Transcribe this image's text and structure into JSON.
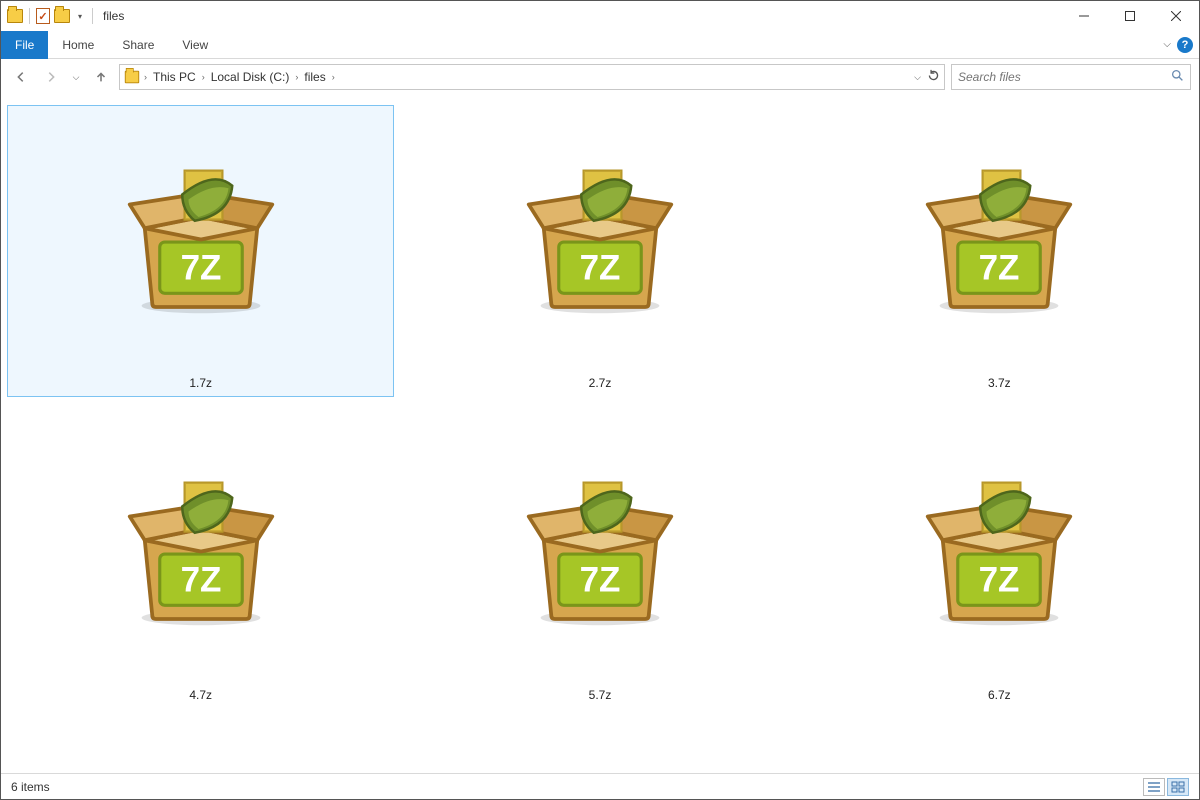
{
  "window": {
    "title": "files"
  },
  "tabs": {
    "file": "File",
    "home": "Home",
    "share": "Share",
    "view": "View"
  },
  "breadcrumbs": [
    "This PC",
    "Local Disk (C:)",
    "files"
  ],
  "search": {
    "placeholder": "Search files"
  },
  "files": [
    {
      "name": "1.7z",
      "selected": true
    },
    {
      "name": "2.7z",
      "selected": false
    },
    {
      "name": "3.7z",
      "selected": false
    },
    {
      "name": "4.7z",
      "selected": false
    },
    {
      "name": "5.7z",
      "selected": false
    },
    {
      "name": "6.7z",
      "selected": false
    }
  ],
  "status": {
    "count_label": "6 items"
  },
  "archive_label": "7Z"
}
